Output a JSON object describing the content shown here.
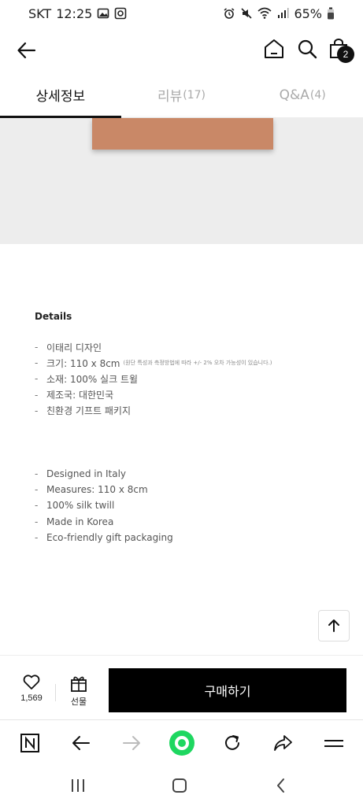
{
  "status": {
    "carrier": "SKT",
    "time": "12:25",
    "battery": "65%"
  },
  "nav": {
    "cart_count": "2"
  },
  "tabs": [
    {
      "label": "상세정보",
      "count": "",
      "active": true
    },
    {
      "label": "리뷰",
      "count": "(17)",
      "active": false
    },
    {
      "label": "Q&A",
      "count": "(4)",
      "active": false
    }
  ],
  "details": {
    "title": "Details",
    "ko_items": [
      {
        "text": "이태리 디자인",
        "note": ""
      },
      {
        "text": "크기: 110 x 8cm",
        "note": "(원단 특성과 측정방법에 따라 +/- 2% 오차 가능성이 있습니다.)"
      },
      {
        "text": "소재: 100% 실크 트윌",
        "note": ""
      },
      {
        "text": "제조국: 대한민국",
        "note": ""
      },
      {
        "text": "친환경 기프트 패키지",
        "note": ""
      }
    ],
    "en_items": [
      "Designed in Italy",
      "Measures: 110 x 8cm",
      "100% silk twill",
      "Made in Korea",
      "Eco-friendly gift packaging"
    ]
  },
  "bottom": {
    "like_count": "1,569",
    "gift_label": "선물",
    "buy_label": "구매하기"
  },
  "colors": {
    "scarf": "#c98867",
    "accent_browser": "#1ed760",
    "buy_button": "#000000"
  }
}
